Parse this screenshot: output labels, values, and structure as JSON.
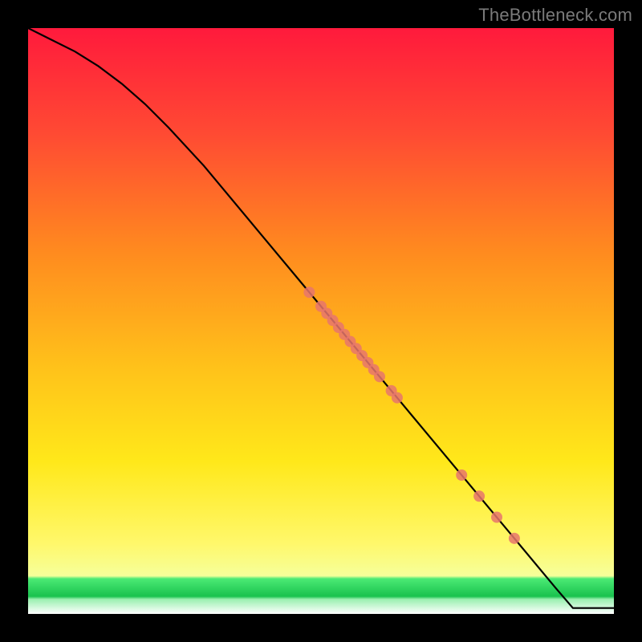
{
  "watermark": "TheBottleneck.com",
  "chart_data": {
    "type": "line",
    "title": "",
    "xlabel": "",
    "ylabel": "",
    "xlim": [
      0,
      100
    ],
    "ylim": [
      0,
      100
    ],
    "background_gradient": {
      "top": "#ff1a3c",
      "mid_upper": "#ff8a1f",
      "mid": "#ffe01a",
      "mid_lower": "#fff86b",
      "green_band_top": "#4bea74",
      "green_band_bottom": "#19c24e",
      "bottom": "#ffffff"
    },
    "series": [
      {
        "name": "curve",
        "type": "line",
        "x": [
          0,
          4,
          8,
          12,
          16,
          20,
          24,
          30,
          40,
          50,
          60,
          70,
          80,
          90,
          93,
          100
        ],
        "y": [
          100,
          98,
          96,
          93.5,
          90.5,
          87,
          83,
          76.5,
          64.5,
          52.5,
          40.5,
          28.5,
          16.5,
          4.5,
          1.0,
          1.0
        ]
      },
      {
        "name": "markers",
        "type": "scatter",
        "x": [
          48,
          50,
          51,
          52,
          53,
          54,
          55,
          56,
          57,
          58,
          59,
          60,
          62,
          63,
          74,
          77,
          80,
          83
        ],
        "y": [
          54.9,
          52.5,
          51.3,
          50.1,
          48.9,
          47.7,
          46.5,
          45.3,
          44.1,
          42.9,
          41.7,
          40.5,
          38.1,
          36.9,
          23.7,
          20.1,
          16.5,
          12.9
        ]
      }
    ]
  }
}
